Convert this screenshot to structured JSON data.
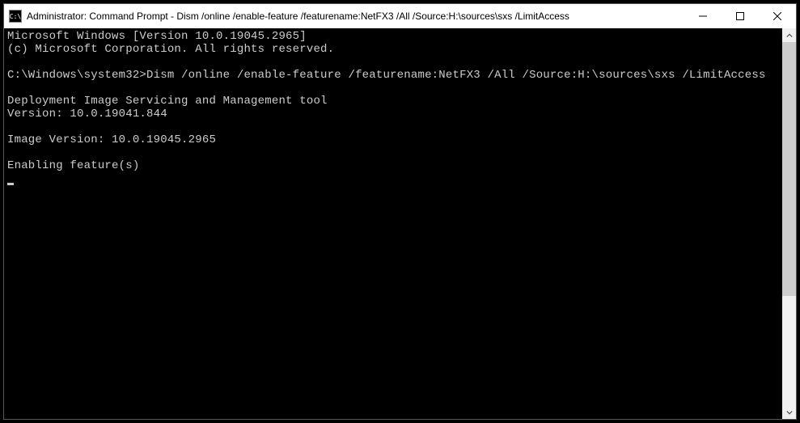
{
  "titlebar": {
    "icon_label": "C:\\",
    "title": "Administrator: Command Prompt - Dism  /online /enable-feature /featurename:NetFX3 /All /Source:H:\\sources\\sxs /LimitAccess"
  },
  "window_controls": {
    "minimize": "Minimize",
    "maximize": "Maximize",
    "close": "Close"
  },
  "terminal": {
    "lines": {
      "l0": "Microsoft Windows [Version 10.0.19045.2965]",
      "l1": "(c) Microsoft Corporation. All rights reserved.",
      "l2": "",
      "l3": "C:\\Windows\\system32>Dism /online /enable-feature /featurename:NetFX3 /All /Source:H:\\sources\\sxs /LimitAccess",
      "l4": "",
      "l5": "Deployment Image Servicing and Management tool",
      "l6": "Version: 10.0.19041.844",
      "l7": "",
      "l8": "Image Version: 10.0.19045.2965",
      "l9": "",
      "l10": "Enabling feature(s)"
    }
  }
}
